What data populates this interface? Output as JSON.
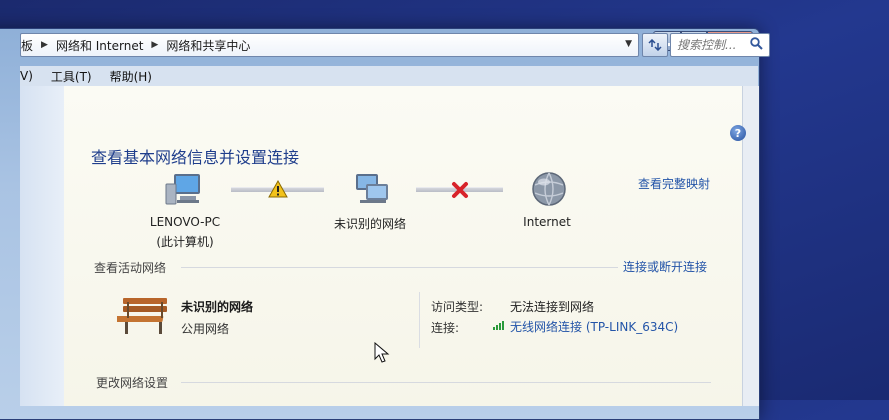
{
  "address": {
    "crumbs": [
      "板",
      "网络和 Internet",
      "网络和共享中心"
    ]
  },
  "search": {
    "placeholder": "搜索控制..."
  },
  "menu": [
    "V)",
    "工具(T)",
    "帮助(H)"
  ],
  "page": {
    "title": "查看基本网络信息并设置连接",
    "full_map_link": "查看完整映射",
    "help_glyph": "?"
  },
  "map": {
    "nodes": [
      {
        "label": "LENOVO-PC",
        "sublabel": "(此计算机)",
        "icon": "computer-icon"
      },
      {
        "label": "未识别的网络",
        "icon": "network-icon"
      },
      {
        "label": "Internet",
        "icon": "globe-icon"
      }
    ],
    "links": [
      {
        "status": "warning",
        "icon": "warning-icon"
      },
      {
        "status": "disconnected",
        "icon": "red-x-icon"
      }
    ]
  },
  "active": {
    "section_title": "查看活动网络",
    "connect_link": "连接或断开连接",
    "network": {
      "name": "未识别的网络",
      "type": "公用网络",
      "icon": "park-bench-icon"
    },
    "access_type_label": "访问类型:",
    "access_type_value": "无法连接到网络",
    "connection_label": "连接:",
    "connection_value": "无线网络连接 (TP-LINK_634C)"
  },
  "change": {
    "section_title": "更改网络设置"
  },
  "colors": {
    "link": "#2354a8",
    "title": "#1f3e8c",
    "desktop": "#23388f"
  }
}
